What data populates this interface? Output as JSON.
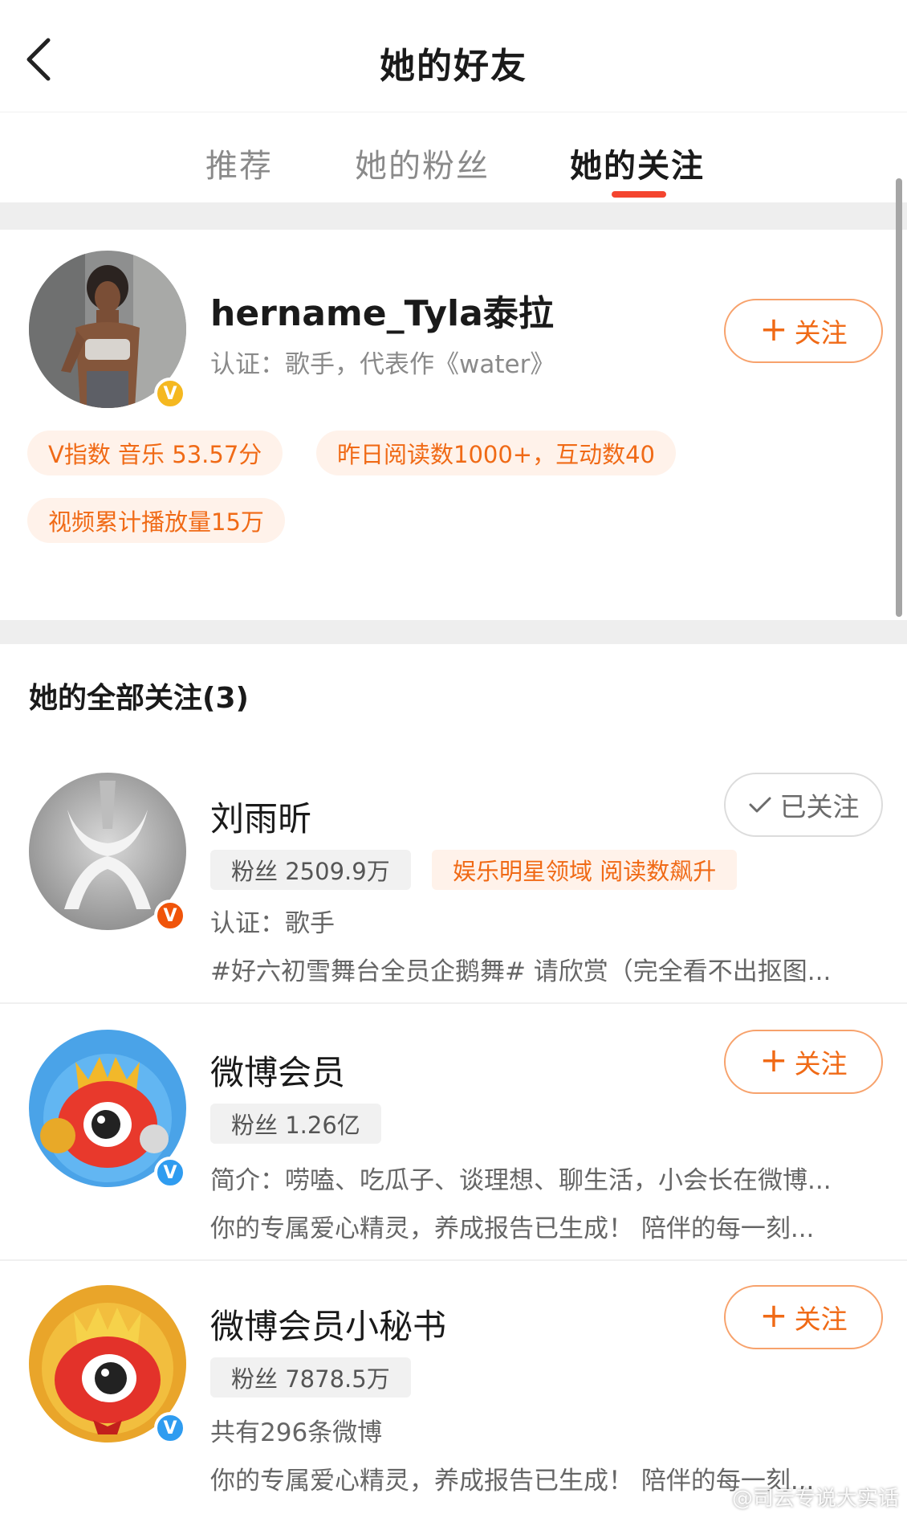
{
  "header": {
    "title": "她的好友"
  },
  "tabs": [
    {
      "label": "推荐"
    },
    {
      "label": "她的粉丝"
    },
    {
      "label": "她的关注"
    }
  ],
  "featured": {
    "name": "hername_Tyla泰拉",
    "verify": "认证：歌手，代表作《water》",
    "follow_label": "关注",
    "tags": [
      "V指数 音乐 53.57分",
      "昨日阅读数1000+，互动数40",
      "视频累计播放量15万"
    ]
  },
  "section": {
    "title": "她的全部关注(3)"
  },
  "follows": [
    {
      "name": "刘雨昕",
      "fans": "粉丝 2509.9万",
      "hot_tag": "娱乐明星领域 阅读数飙升",
      "line1": "认证：歌手",
      "line2": "#好六初雪舞台全员企鹅舞# 请欣赏（完全看不出抠图...",
      "button": "已关注"
    },
    {
      "name": "微博会员",
      "fans": "粉丝 1.26亿",
      "line1": "简介：唠嗑、吃瓜子、谈理想、聊生活，小会长在微博...",
      "line2": "你的专属爱心精灵，养成报告已生成！ 陪伴的每一刻...",
      "button": "关注"
    },
    {
      "name": "微博会员小秘书",
      "fans": "粉丝 7878.5万",
      "line1": "共有296条微博",
      "line2": "你的专属爱心精灵，养成报告已生成！ 陪伴的每一刻...",
      "button": "关注"
    }
  ],
  "watermark": "@司云专说大实话",
  "colors": {
    "accent": "#f06a16",
    "tab_indicator": "#f4452f",
    "verified_gold": "#f5b820",
    "verified_orange": "#f0540a",
    "verified_blue": "#2f9cf0"
  }
}
